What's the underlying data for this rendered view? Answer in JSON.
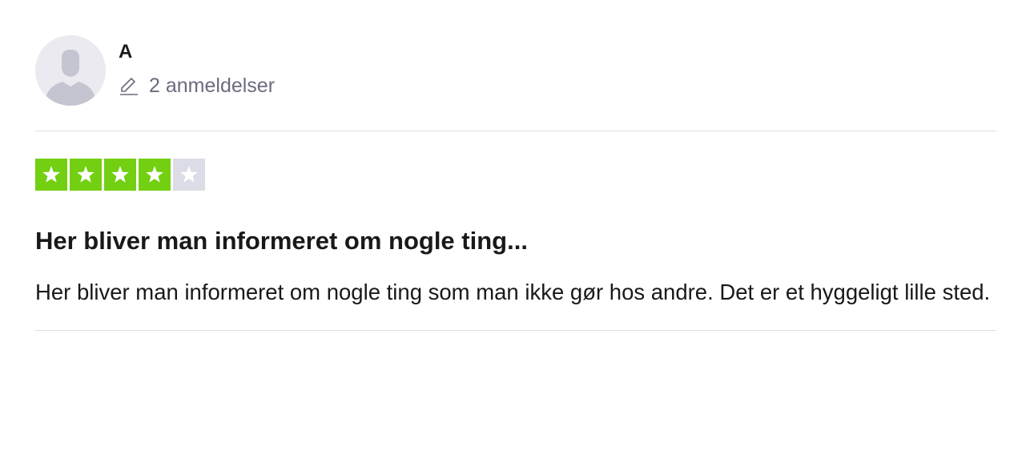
{
  "reviewer": {
    "name": "A",
    "review_count_text": "2 anmeldelser",
    "avatar_icon": "default-user-avatar"
  },
  "rating": {
    "stars": 4,
    "max": 5,
    "filled_color": "#73cf11",
    "empty_color": "#dcdce6"
  },
  "review": {
    "title": "Her bliver man informeret om nogle ting...",
    "body": "Her bliver man informeret om nogle ting som man ikke gør hos andre. Det er et hyggeligt lille sted."
  }
}
